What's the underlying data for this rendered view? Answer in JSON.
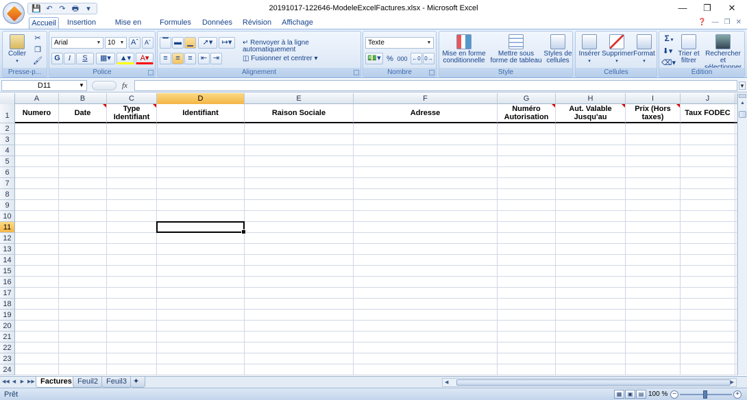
{
  "window": {
    "title": "20191017-122646-ModeleExcelFactures.xlsx - Microsoft Excel"
  },
  "tabs": [
    "Accueil",
    "Insertion",
    "Mise en page",
    "Formules",
    "Données",
    "Révision",
    "Affichage"
  ],
  "ribbon": {
    "clipboard": {
      "label": "Presse-p...",
      "paste": "Coller"
    },
    "font": {
      "label": "Police",
      "name": "Arial",
      "size": "10",
      "bold": "G",
      "italic": "I",
      "underline": "S"
    },
    "alignment": {
      "label": "Alignement",
      "wrap": "Renvoyer à la ligne automatiquement",
      "merge": "Fusionner et centrer"
    },
    "number": {
      "label": "Nombre",
      "format": "Texte",
      "percent": "%",
      "thousands": "000"
    },
    "style": {
      "label": "Style",
      "conditional": "Mise en forme conditionnelle",
      "table": "Mettre sous forme de tableau",
      "cellstyles": "Styles de cellules"
    },
    "cells": {
      "label": "Cellules",
      "insert": "Insérer",
      "delete": "Supprimer",
      "format": "Format"
    },
    "editing": {
      "label": "Édition",
      "sum": "Σ",
      "sort": "Trier et filtrer",
      "find": "Rechercher et sélectionner"
    }
  },
  "formula_bar": {
    "cell_ref": "D11",
    "fx": "fx",
    "content": ""
  },
  "columns": [
    "A",
    "B",
    "C",
    "D",
    "E",
    "F",
    "G",
    "H",
    "I",
    "J"
  ],
  "selected_column": "D",
  "selected_row": 11,
  "header_row": [
    "Numero",
    "Date",
    "Type Identifiant",
    "Identifiant",
    "Raison Sociale",
    "Adresse",
    "Numéro Autorisation",
    "Aut. Valable Jusqu'au",
    "Prix (Hors taxes)",
    "Taux FODEC"
  ],
  "rows": [
    "1",
    "2",
    "3",
    "4",
    "5",
    "6",
    "7",
    "8",
    "9",
    "10",
    "11",
    "12",
    "13",
    "14",
    "15",
    "16",
    "17",
    "18",
    "19",
    "20",
    "21",
    "22",
    "23",
    "24"
  ],
  "sheets": [
    "Factures",
    "Feuil2",
    "Feuil3"
  ],
  "status": {
    "ready": "Prêt",
    "zoom": "100 %"
  }
}
